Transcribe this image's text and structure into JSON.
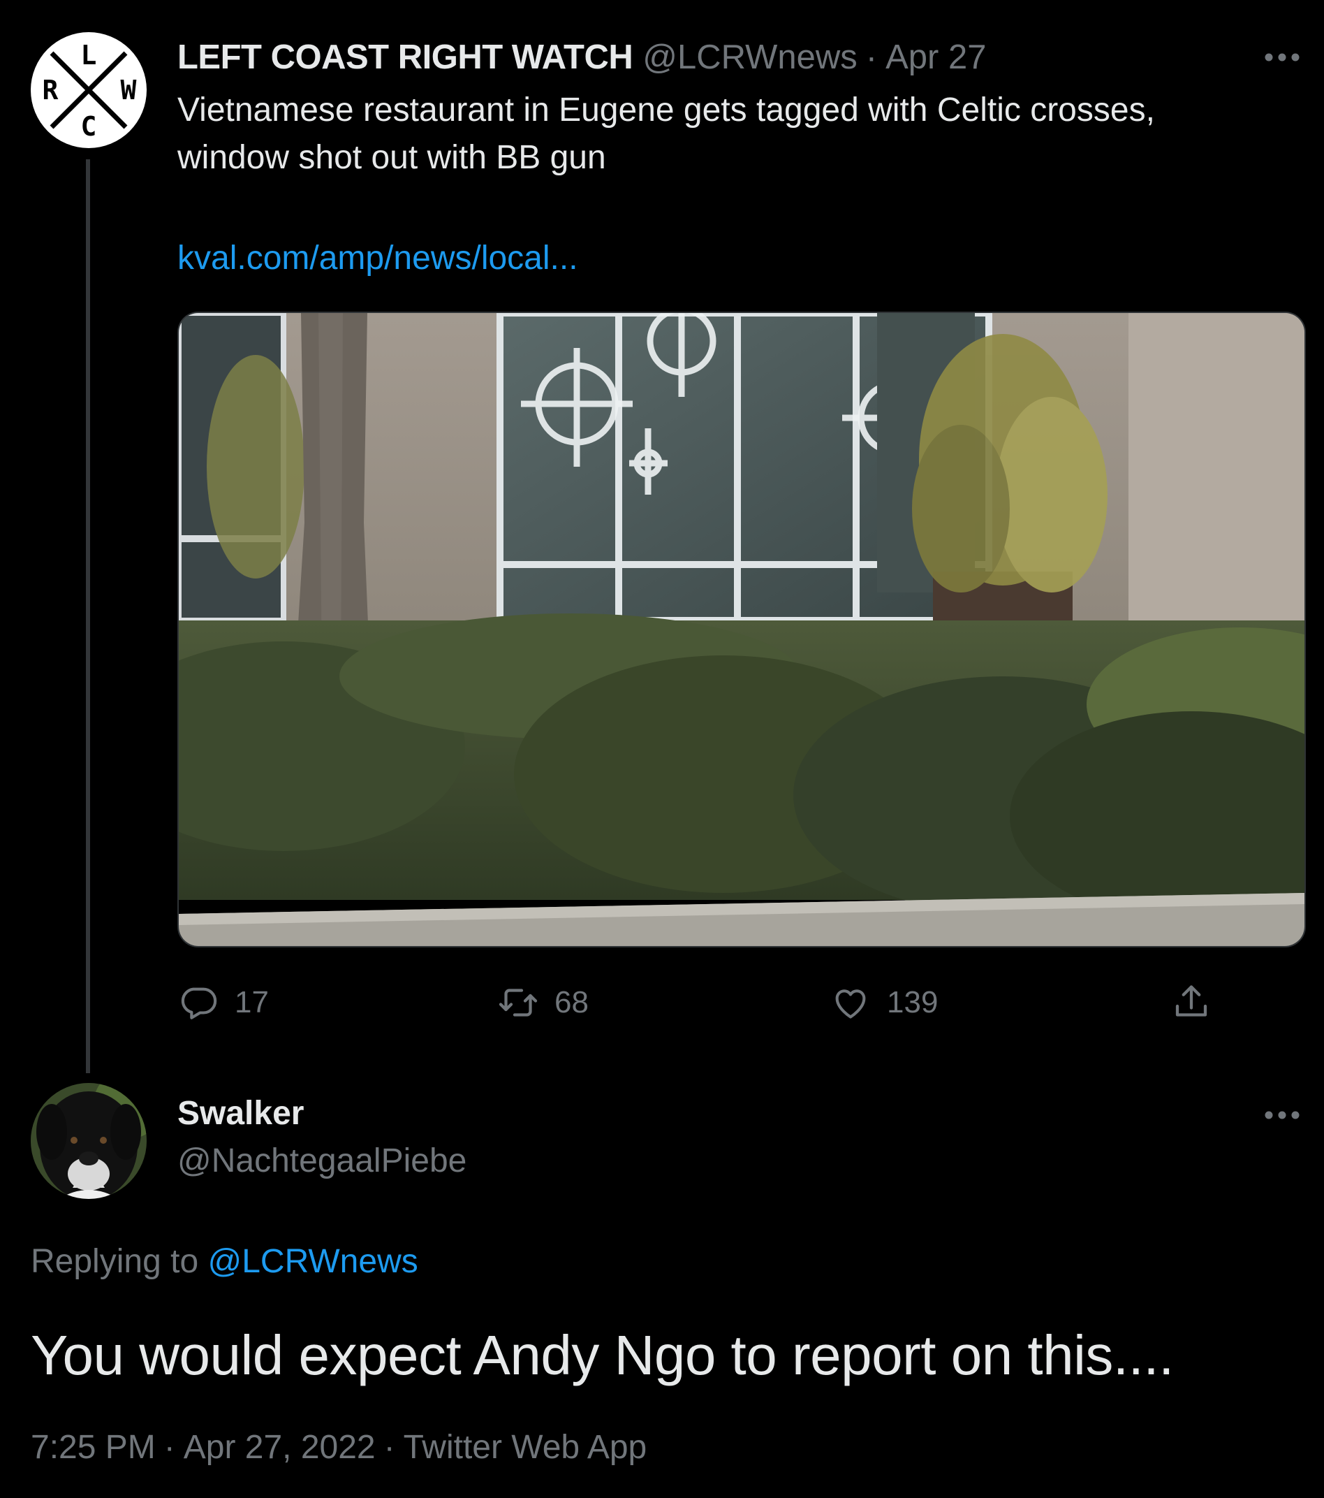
{
  "original_tweet": {
    "avatar_letters": {
      "top": "L",
      "left": "R",
      "right": "W",
      "bottom": "C"
    },
    "author_name": "LEFT COAST RIGHT WATCH",
    "author_handle": "@LCRWnews",
    "separator": "·",
    "date": "Apr 27",
    "text": "Vietnamese restaurant in Eugene gets tagged with Celtic crosses, window shot out with BB gun",
    "link_text": "kval.com/amp/news/local...",
    "actions": {
      "reply_count": "17",
      "retweet_count": "68",
      "like_count": "139"
    }
  },
  "reply_tweet": {
    "author_name": "Swalker",
    "author_handle": "@NachtegaalPiebe",
    "replying_prefix": "Replying to",
    "replying_handle": "@LCRWnews",
    "text": "You would expect Andy Ngo to report on this....",
    "time": "7:25 PM",
    "date": "Apr 27, 2022",
    "source": "Twitter Web App",
    "separator": "·"
  },
  "icons": {
    "more": "more-horizontal-icon",
    "reply": "speech-bubble-icon",
    "retweet": "retweet-arrows-icon",
    "like": "heart-icon",
    "share": "share-upload-icon"
  },
  "colors": {
    "background": "#000000",
    "text_primary": "#e7e9ea",
    "text_secondary": "#71767b",
    "link": "#1d9bf0",
    "thread_line": "#333639"
  }
}
